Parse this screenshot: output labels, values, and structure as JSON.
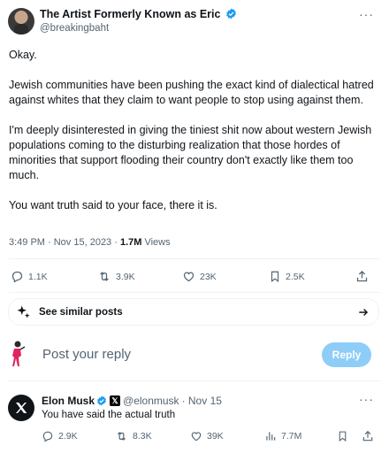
{
  "post": {
    "author_name": "The Artist Formerly Known as Eric",
    "author_handle": "@breakingbaht",
    "paragraphs": [
      "Okay.",
      "Jewish communities have been pushing the exact kind of dialectical hatred against whites that they claim to want people to stop using against them.",
      "I'm deeply disinterested in giving the tiniest shit now about western Jewish populations coming to the disturbing realization that those hordes of minorities that support flooding their country don't exactly like them too much.",
      "You want truth said to your face, there it is."
    ],
    "timestamp": "3:49 PM · Nov 15, 2023 · ",
    "views_count": "1.7M",
    "views_label": " Views",
    "replies": "1.1K",
    "reposts": "3.9K",
    "likes": "23K",
    "bookmarks": "2.5K"
  },
  "similar": {
    "label": "See similar posts"
  },
  "composer": {
    "placeholder": "Post your reply",
    "button_label": "Reply"
  },
  "reply": {
    "author_name": "Elon Musk",
    "affiliate_badge": "𝕏",
    "author_handle": "@elonmusk",
    "date": "· Nov 15",
    "text": "You have said the actual truth",
    "replies": "2.9K",
    "reposts": "8.3K",
    "likes": "39K",
    "views": "7.7M"
  },
  "icons": {
    "verified": "verified-badge-icon",
    "more": "more-horizontal-icon",
    "reply": "reply-icon",
    "repost": "repost-icon",
    "like": "heart-icon",
    "bookmark": "bookmark-icon",
    "share": "share-icon",
    "similar": "sparkle-icon",
    "arrow": "arrow-right-icon",
    "views": "views-chart-icon"
  },
  "colors": {
    "verified": "#1d9bf0",
    "muted": "#536471",
    "reply_button": "#8ecdf8",
    "text": "#0f1419"
  }
}
